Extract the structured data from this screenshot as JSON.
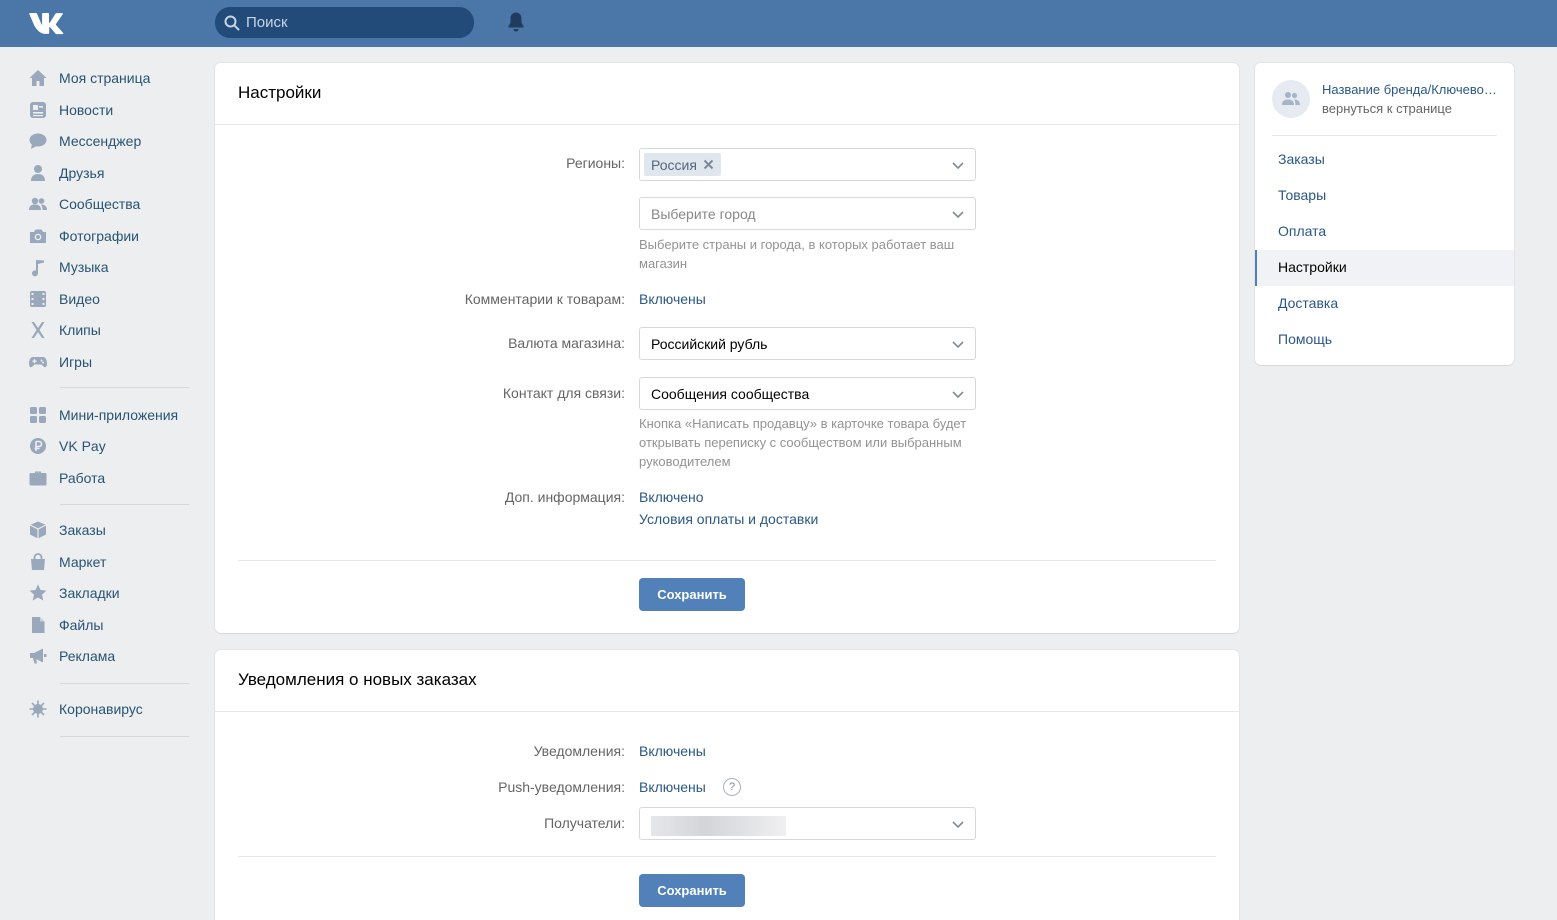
{
  "header": {
    "logo": "VK",
    "search_placeholder": "Поиск",
    "icons": [
      "search-icon",
      "bell-icon"
    ]
  },
  "leftnav": {
    "groups": [
      [
        {
          "label": "Моя страница",
          "icon": "home-icon"
        },
        {
          "label": "Новости",
          "icon": "news-icon"
        },
        {
          "label": "Мессенджер",
          "icon": "messenger-icon"
        },
        {
          "label": "Друзья",
          "icon": "friends-icon"
        },
        {
          "label": "Сообщества",
          "icon": "communities-icon"
        },
        {
          "label": "Фотографии",
          "icon": "camera-icon"
        },
        {
          "label": "Музыка",
          "icon": "music-icon"
        },
        {
          "label": "Видео",
          "icon": "video-icon"
        },
        {
          "label": "Клипы",
          "icon": "clips-icon"
        },
        {
          "label": "Игры",
          "icon": "gamepad-icon"
        }
      ],
      [
        {
          "label": "Мини-приложения",
          "icon": "apps-icon"
        },
        {
          "label": "VK Pay",
          "icon": "vkpay-icon"
        },
        {
          "label": "Работа",
          "icon": "briefcase-icon"
        }
      ],
      [
        {
          "label": "Заказы",
          "icon": "box-icon"
        },
        {
          "label": "Маркет",
          "icon": "bag-icon"
        },
        {
          "label": "Закладки",
          "icon": "star-icon"
        },
        {
          "label": "Файлы",
          "icon": "file-icon"
        },
        {
          "label": "Реклама",
          "icon": "megaphone-icon"
        }
      ],
      [
        {
          "label": "Коронавирус",
          "icon": "virus-icon"
        }
      ]
    ]
  },
  "settings": {
    "title": "Настройки",
    "regions_label": "Регионы:",
    "region_tag": "Россия",
    "city_placeholder": "Выберите город",
    "regions_hint": "Выберите страны и города, в которых работает ваш магазин",
    "comments_label": "Комментарии к товарам:",
    "comments_value": "Включены",
    "currency_label": "Валюта магазина:",
    "currency_value": "Российский рубль",
    "contact_label": "Контакт для связи:",
    "contact_value": "Сообщения сообщества",
    "contact_hint": "Кнопка «Написать продавцу» в карточке товара будет открывать переписку с сообществом или выбранным руководителем",
    "extra_label": "Доп. информация:",
    "extra_value": "Включено",
    "extra_link": "Условия оплаты и доставки",
    "save_label": "Сохранить"
  },
  "notifications": {
    "title": "Уведомления о новых заказах",
    "notif_label": "Уведомления:",
    "notif_value": "Включены",
    "push_label": "Push-уведомления:",
    "push_value": "Включены",
    "help_glyph": "?",
    "recipients_label": "Получатели:",
    "save_label": "Сохранить"
  },
  "rightpanel": {
    "brand_name": "Название бренда/Ключевое слово",
    "back_link": "вернуться к странице",
    "items": [
      {
        "label": "Заказы",
        "active": false
      },
      {
        "label": "Товары",
        "active": false
      },
      {
        "label": "Оплата",
        "active": false
      },
      {
        "label": "Настройки",
        "active": true
      },
      {
        "label": "Доставка",
        "active": false
      },
      {
        "label": "Помощь",
        "active": false
      }
    ]
  },
  "colors": {
    "header_bg": "#4a76a8",
    "link": "#2a5885",
    "button": "#5181b8",
    "page_bg": "#edeef0"
  }
}
